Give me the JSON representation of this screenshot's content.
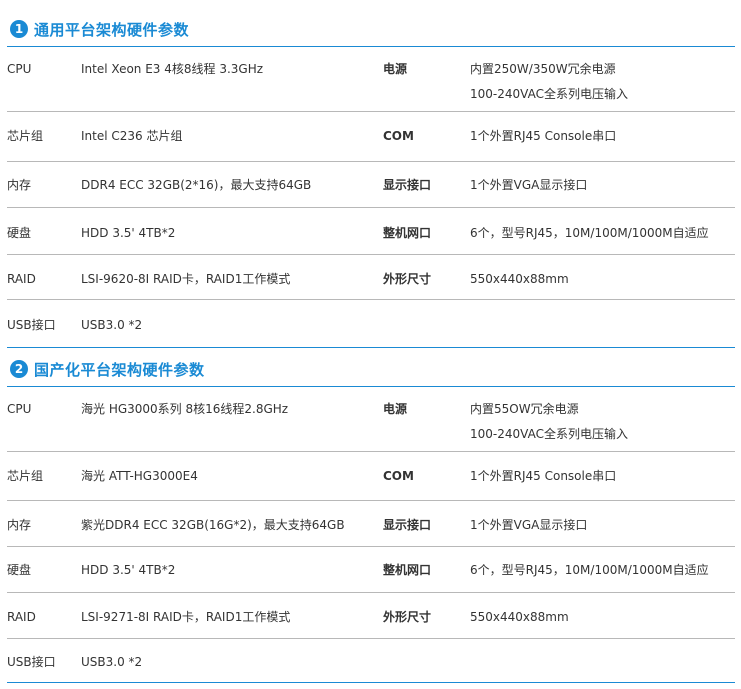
{
  "sections": [
    {
      "number": "1",
      "title": "通用平台架构硬件参数",
      "rows": [
        {
          "label": "CPU",
          "value": "Intel Xeon E3 4核8线程 3.3GHz",
          "rlabel": "电源",
          "rvalue": [
            "内置250W/350W冗余电源",
            "100-240VAC全系列电压输入"
          ]
        },
        {
          "label": "芯片组",
          "value": "Intel C236 芯片组",
          "rlabel": "COM",
          "rvalue": [
            "1个外置RJ45 Console串口"
          ]
        },
        {
          "label": "内存",
          "value": "DDR4 ECC 32GB(2*16)，最大支持64GB",
          "rlabel": "显示接口",
          "rvalue": [
            "1个外置VGA显示接口"
          ]
        },
        {
          "label": "硬盘",
          "value": "HDD 3.5' 4TB*2",
          "rlabel": "整机网口",
          "rvalue": [
            "6个，型号RJ45，10M/100M/1000M自适应"
          ]
        },
        {
          "label": "RAID",
          "value": "LSI-9620-8I RAID卡，RAID1工作模式",
          "rlabel": "外形尺寸",
          "rvalue": [
            "550x440x88mm"
          ]
        },
        {
          "label": "USB接口",
          "value": "USB3.0 *2",
          "rlabel": "",
          "rvalue": []
        }
      ]
    },
    {
      "number": "2",
      "title": "国产化平台架构硬件参数",
      "rows": [
        {
          "label": "CPU",
          "value": "海光 HG3000系列 8核16线程2.8GHz",
          "rlabel": "电源",
          "rvalue": [
            "内置55OW冗余电源",
            "100-240VAC全系列电压输入"
          ]
        },
        {
          "label": "芯片组",
          "value": "海光 ATT-HG3000E4",
          "rlabel": "COM",
          "rvalue": [
            "1个外置RJ45 Console串口"
          ]
        },
        {
          "label": "内存",
          "value": "紫光DDR4 ECC 32GB(16G*2)，最大支持64GB",
          "rlabel": "显示接口",
          "rvalue": [
            "1个外置VGA显示接口"
          ]
        },
        {
          "label": "硬盘",
          "value": "HDD 3.5' 4TB*2",
          "rlabel": "整机网口",
          "rvalue": [
            "6个，型号RJ45，10M/100M/1000M自适应"
          ]
        },
        {
          "label": "RAID",
          "value": "LSI-9271-8I RAID卡，RAID1工作模式",
          "rlabel": "外形尺寸",
          "rvalue": [
            "550x440x88mm"
          ]
        },
        {
          "label": "USB接口",
          "value": "USB3.0 *2",
          "rlabel": "",
          "rvalue": []
        }
      ]
    }
  ]
}
